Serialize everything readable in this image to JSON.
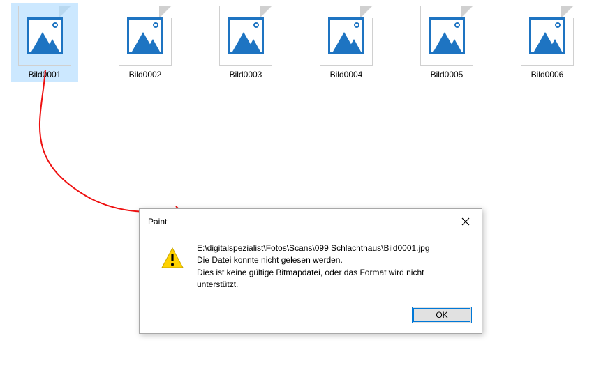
{
  "files": [
    {
      "name": "Bild0001",
      "selected": true
    },
    {
      "name": "Bild0002",
      "selected": false
    },
    {
      "name": "Bild0003",
      "selected": false
    },
    {
      "name": "Bild0004",
      "selected": false
    },
    {
      "name": "Bild0005",
      "selected": false
    },
    {
      "name": "Bild0006",
      "selected": false
    }
  ],
  "dialog": {
    "title": "Paint",
    "path": "E:\\digitalspezialist\\Fotos\\Scans\\099 Schlachthaus\\Bild0001.jpg",
    "line2": "Die Datei konnte nicht gelesen werden.",
    "line3": "Dies ist keine gültige Bitmapdatei, oder das Format wird nicht unterstützt.",
    "ok_label": "OK"
  }
}
